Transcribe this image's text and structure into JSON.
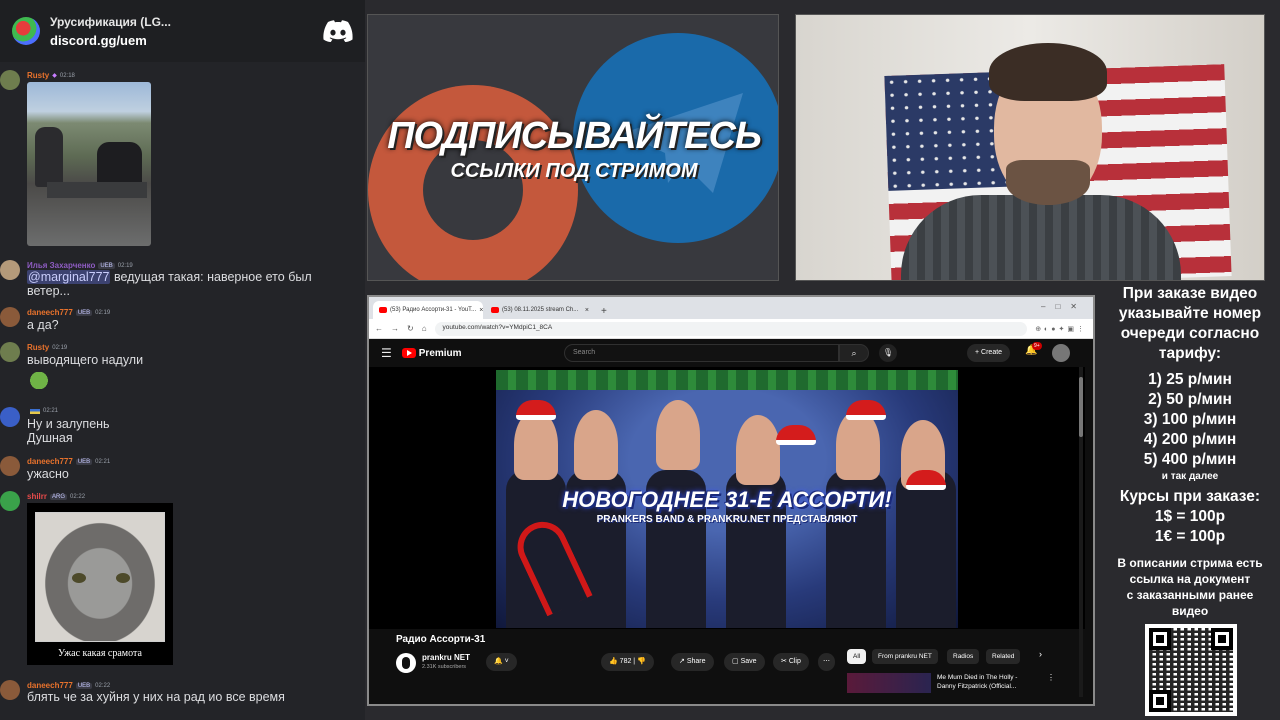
{
  "discord": {
    "server_name": "Урусификация (LG...",
    "invite": "discord.gg/uem",
    "messages": [
      {
        "user": "Rusty",
        "badge": "",
        "time": "02:18",
        "text": "",
        "color": "#e8722c"
      },
      {
        "user": "Илья Захарченко",
        "badge": "UEB",
        "time": "02:19",
        "mention": "@marginal777",
        "text": " ведущая такая: наверное ето был ветер...",
        "color": "#b05cd6"
      },
      {
        "user": "daneech777",
        "badge": "UEB",
        "time": "02:19",
        "text": "а да?",
        "color": "#e8722c"
      },
      {
        "user": "Rusty",
        "badge": "",
        "time": "02:19",
        "text": "выводящего надули",
        "color": "#e8722c"
      },
      {
        "user": "",
        "badge": "",
        "time": "02:21",
        "text_line1": "Ну и залупень",
        "text_line2": "Душная",
        "color": "#e6c84a"
      },
      {
        "user": "daneech777",
        "badge": "UEB",
        "time": "02:21",
        "text": "ужасно",
        "color": "#e8722c"
      },
      {
        "user": "shilrr",
        "badge": "ARG",
        "time": "02:22",
        "text": "",
        "caption": "Ужас какая срамота",
        "color": "#e64a4a"
      },
      {
        "user": "daneech777",
        "badge": "UEB",
        "time": "02:22",
        "text": "блять че за хуйня у них на рад ио все время",
        "color": "#e8722c"
      }
    ]
  },
  "promo": {
    "title": "ПОДПИСЫВАЙТЕСЬ",
    "subtitle": "ССЫЛКИ ПОД СТРИМОМ"
  },
  "browser": {
    "tab1": "(53) Радио Ассорти-31 - YouT...",
    "tab2": "(53) 08.11.2025 stream Ch...",
    "url": "youtube.com/watch?v=YMdpiC1_8CA",
    "yt": {
      "brand": "Premium",
      "search_placeholder": "Search",
      "create": "Create",
      "notif_count": "9+",
      "video_title_overlay": "НОВОГОДНЕЕ 31-Е АССОРТИ!",
      "video_sub_overlay": "PRANKERS BAND & PRANKRU.NET ПРЕДСТАВЛЯЮТ",
      "title": "Радио Ассорти-31",
      "channel": "prankru NET",
      "subs": "2.31K subscribers",
      "likes": "782",
      "share": "Share",
      "save": "Save",
      "clip": "Clip",
      "chips": [
        "All",
        "From prankru NET",
        "Radios",
        "Related"
      ],
      "rec_title": "Me Mum Died in The Holly - Danny Fitzpatrick (Official..."
    }
  },
  "pricing": {
    "intro": [
      "При заказе видео",
      "указывайте номер",
      "очереди согласно",
      "тарифу:"
    ],
    "tiers": [
      "1) 25 р/мин",
      "2) 50 р/мин",
      "3) 100 р/мин",
      "4) 200 р/мин",
      "5) 400 р/мин"
    ],
    "etc": "и так далее",
    "rates_title": "Курсы при заказе:",
    "rates": [
      "1$ = 100р",
      "1€ = 100р"
    ],
    "desc": [
      "В описании стрима есть",
      "ссылка на документ",
      "с заказанными ранее",
      "видео"
    ]
  },
  "colors": {
    "discord_bg": "#232428",
    "yt_red": "#ff0000",
    "page_bg": "#2a2a2e"
  }
}
